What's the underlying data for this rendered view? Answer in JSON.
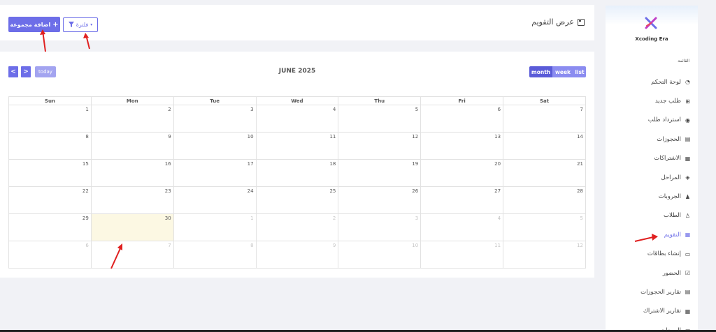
{
  "header": {
    "title": "عرض التقويم",
    "add_group_label": "اضافة مجموعة",
    "filter_label": "فلترة"
  },
  "calendar": {
    "title": "JUNE 2025",
    "today_label": "today",
    "prev_label": "<",
    "next_label": ">",
    "views": [
      "month",
      "week",
      "list"
    ],
    "active_view": "month",
    "weekdays": [
      "Sun",
      "Mon",
      "Tue",
      "Wed",
      "Thu",
      "Fri",
      "Sat"
    ],
    "weeks": [
      [
        {
          "d": "1"
        },
        {
          "d": "2"
        },
        {
          "d": "3"
        },
        {
          "d": "4"
        },
        {
          "d": "5"
        },
        {
          "d": "6"
        },
        {
          "d": "7"
        }
      ],
      [
        {
          "d": "8"
        },
        {
          "d": "9"
        },
        {
          "d": "10"
        },
        {
          "d": "11"
        },
        {
          "d": "12"
        },
        {
          "d": "13"
        },
        {
          "d": "14"
        }
      ],
      [
        {
          "d": "15"
        },
        {
          "d": "16"
        },
        {
          "d": "17"
        },
        {
          "d": "18"
        },
        {
          "d": "19"
        },
        {
          "d": "20"
        },
        {
          "d": "21"
        }
      ],
      [
        {
          "d": "22"
        },
        {
          "d": "23"
        },
        {
          "d": "24"
        },
        {
          "d": "25"
        },
        {
          "d": "26"
        },
        {
          "d": "27"
        },
        {
          "d": "28"
        }
      ],
      [
        {
          "d": "29"
        },
        {
          "d": "30",
          "today": true
        },
        {
          "d": "1",
          "other": true
        },
        {
          "d": "2",
          "other": true
        },
        {
          "d": "3",
          "other": true
        },
        {
          "d": "4",
          "other": true
        },
        {
          "d": "5",
          "other": true
        }
      ],
      [
        {
          "d": "6",
          "other": true
        },
        {
          "d": "7",
          "other": true
        },
        {
          "d": "8",
          "other": true
        },
        {
          "d": "9",
          "other": true
        },
        {
          "d": "10",
          "other": true
        },
        {
          "d": "11",
          "other": true
        },
        {
          "d": "12",
          "other": true
        }
      ]
    ]
  },
  "sidebar": {
    "brand": "Xcoding Era",
    "menu_header": "القائمة",
    "items": [
      {
        "label": "لوحة التحكم",
        "icon": "dashboard-icon",
        "glyph": "◔"
      },
      {
        "label": "طلب جديد",
        "icon": "cart-icon",
        "glyph": "⊞"
      },
      {
        "label": "استرداد طلب",
        "icon": "refund-icon",
        "glyph": "◉"
      },
      {
        "label": "الحجوزات",
        "icon": "bookings-icon",
        "glyph": "▤"
      },
      {
        "label": "الاشتراكات",
        "icon": "subscriptions-icon",
        "glyph": "▦"
      },
      {
        "label": "المراحل",
        "icon": "layers-icon",
        "glyph": "◈"
      },
      {
        "label": "الجروبات",
        "icon": "users-icon",
        "glyph": "♟"
      },
      {
        "label": "الطلاب",
        "icon": "student-icon",
        "glyph": "♙"
      },
      {
        "label": "التقويم",
        "icon": "calendar-icon",
        "glyph": "▦",
        "active": true
      },
      {
        "label": "إنشاء بطاقات",
        "icon": "card-icon",
        "glyph": "▭"
      },
      {
        "label": "الحضور",
        "icon": "attendance-icon",
        "glyph": "☑"
      },
      {
        "label": "تقارير الحجوزات",
        "icon": "booking-report-icon",
        "glyph": "▤"
      },
      {
        "label": "تقارير الاشتراك",
        "icon": "subscription-report-icon",
        "glyph": "▦"
      },
      {
        "label": "المبيعات",
        "icon": "sales-icon",
        "glyph": "▬"
      }
    ]
  },
  "colors": {
    "accent": "#6d6ee8",
    "today_bg": "#fcf8e3",
    "arrow": "#e02020"
  }
}
